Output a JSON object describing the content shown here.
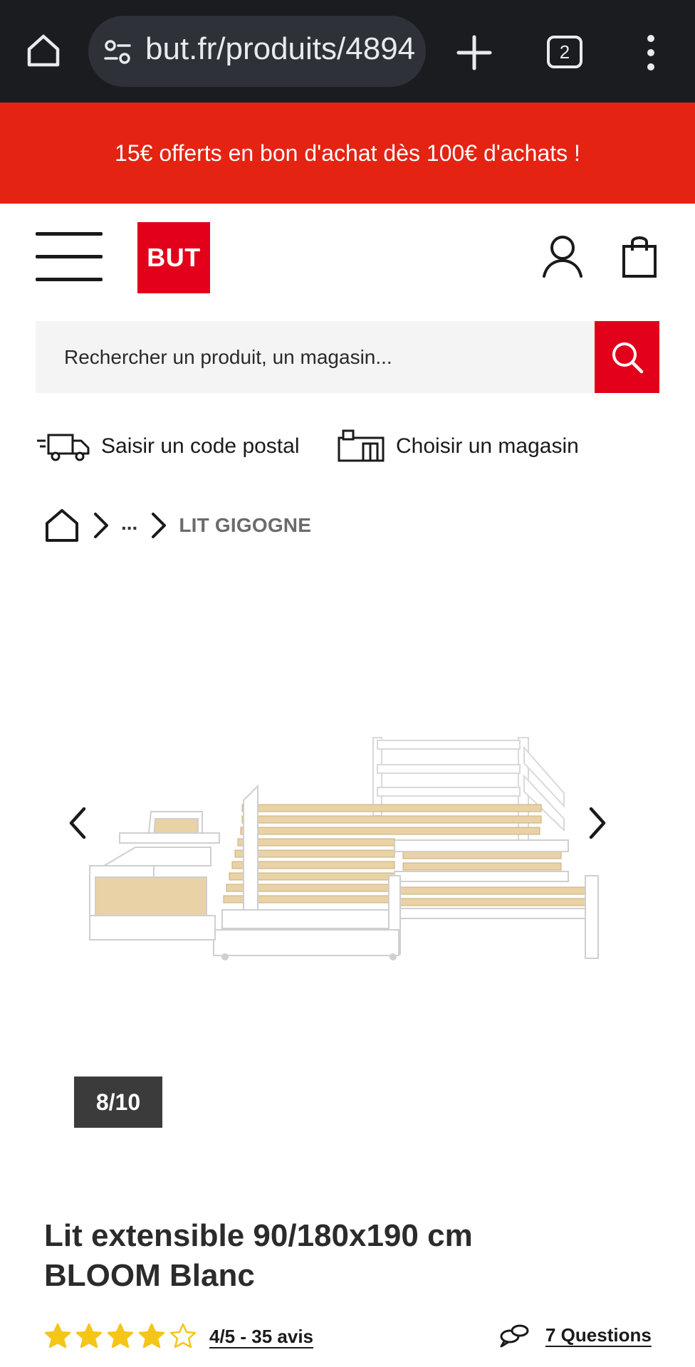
{
  "browser": {
    "url": "but.fr/produits/4894",
    "tab_count": "2",
    "icons": {
      "home": "home-icon",
      "site_info": "site-settings-icon",
      "new_tab": "plus-icon",
      "menu": "kebab-menu-icon"
    }
  },
  "promo": {
    "text": "15€ offerts en bon d'achat dès 100€ d'achats !"
  },
  "header": {
    "logo": "BUT",
    "icons": {
      "menu": "hamburger-icon",
      "account": "user-icon",
      "cart": "shopping-bag-icon"
    }
  },
  "search": {
    "placeholder": "Rechercher un produit, un magasin...",
    "icon": "search-icon"
  },
  "delivery": {
    "postal_label": "Saisir un code postal",
    "store_label": "Choisir un magasin",
    "icons": {
      "postal": "delivery-truck-icon",
      "store": "store-icon"
    }
  },
  "breadcrumb": {
    "ellipsis": "...",
    "current": "LIT GIGOGNE"
  },
  "gallery": {
    "counter": "8/10",
    "current_index": 8,
    "total": 10,
    "image_subject": "white extendable trundle bed with drawers"
  },
  "product": {
    "title_line1": "Lit extensible 90/180x190 cm",
    "title_line2": "BLOOM Blanc",
    "rating_value": 4,
    "rating_max": 5,
    "rating_text": "4/5 - 35 avis",
    "questions_text": "7 Questions"
  },
  "colors": {
    "brand_red": "#e2001a",
    "promo_red": "#e42313",
    "star": "#f5c518",
    "browser_bg": "#1b1c1f"
  }
}
